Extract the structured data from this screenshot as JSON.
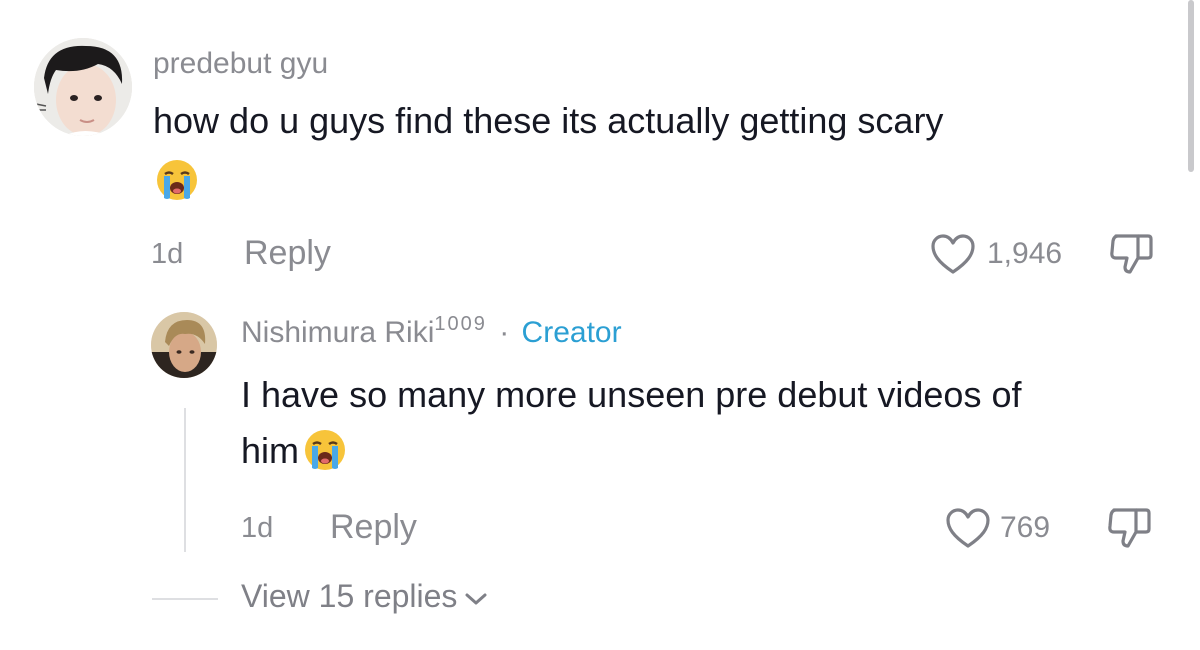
{
  "comments": [
    {
      "username": "predebut gyu",
      "text": "how do u guys find these its actually getting scary",
      "emoji": "loudly-crying-face",
      "age": "1d",
      "reply_label": "Reply",
      "likes": "1,946"
    }
  ],
  "reply": {
    "username": "Nishimura Riki",
    "superscript": "1009",
    "separator": "·",
    "creator_label": "Creator",
    "text_line1": "I have so many more unseen pre debut videos of",
    "text_line2": "him",
    "emoji": "loudly-crying-face",
    "age": "1d",
    "reply_label": "Reply",
    "likes": "769"
  },
  "view_replies": {
    "label": "View 15 replies"
  },
  "colors": {
    "text": "#161823",
    "muted": "#8a8b91",
    "creator": "#2b9fd3"
  },
  "icons": [
    "heart-outline-icon",
    "dislike-icon",
    "chevron-down-icon",
    "loudly-crying-face-emoji"
  ]
}
